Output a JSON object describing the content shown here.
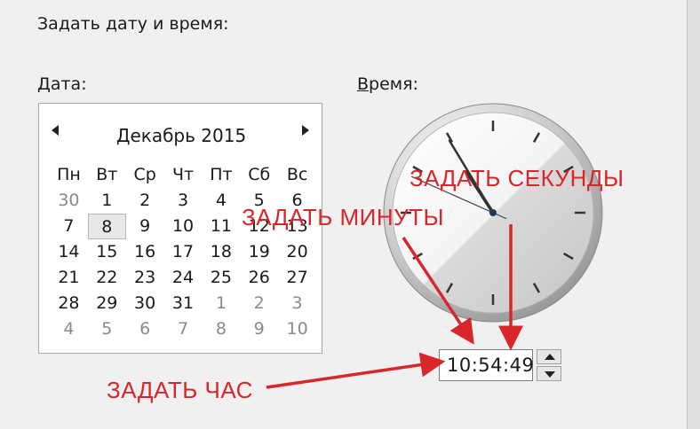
{
  "dialog": {
    "title": "Задать дату и время:",
    "date_label_accel": "Д",
    "date_label_rest": "ата:",
    "time_label_accel": "В",
    "time_label_rest": "ремя:"
  },
  "calendar": {
    "month_year": "Декабрь 2015",
    "weekdays": [
      "Пн",
      "Вт",
      "Ср",
      "Чт",
      "Пт",
      "Сб",
      "Вс"
    ],
    "weeks": [
      [
        {
          "d": "30",
          "o": true
        },
        {
          "d": "1"
        },
        {
          "d": "2"
        },
        {
          "d": "3"
        },
        {
          "d": "4"
        },
        {
          "d": "5"
        },
        {
          "d": "6"
        }
      ],
      [
        {
          "d": "7"
        },
        {
          "d": "8",
          "sel": true
        },
        {
          "d": "9"
        },
        {
          "d": "10"
        },
        {
          "d": "11"
        },
        {
          "d": "12"
        },
        {
          "d": "13"
        }
      ],
      [
        {
          "d": "14"
        },
        {
          "d": "15"
        },
        {
          "d": "16"
        },
        {
          "d": "17"
        },
        {
          "d": "18"
        },
        {
          "d": "19"
        },
        {
          "d": "20"
        }
      ],
      [
        {
          "d": "21"
        },
        {
          "d": "22"
        },
        {
          "d": "23"
        },
        {
          "d": "24"
        },
        {
          "d": "25"
        },
        {
          "d": "26"
        },
        {
          "d": "27"
        }
      ],
      [
        {
          "d": "28"
        },
        {
          "d": "29"
        },
        {
          "d": "30"
        },
        {
          "d": "31"
        },
        {
          "d": "1",
          "o": true
        },
        {
          "d": "2",
          "o": true
        },
        {
          "d": "3",
          "o": true
        }
      ],
      [
        {
          "d": "4",
          "o": true
        },
        {
          "d": "5",
          "o": true
        },
        {
          "d": "6",
          "o": true
        },
        {
          "d": "7",
          "o": true
        },
        {
          "d": "8",
          "o": true
        },
        {
          "d": "9",
          "o": true
        },
        {
          "d": "10",
          "o": true
        }
      ]
    ],
    "prev_icon": "triangle-left-icon",
    "next_icon": "triangle-right-icon"
  },
  "time": {
    "hour": 10,
    "minute": 54,
    "second": 49,
    "value": "10:54:49",
    "spin_up_icon": "triangle-up-icon",
    "spin_down_icon": "triangle-down-icon"
  },
  "annotations": {
    "seconds": "ЗАДАТЬ СЕКУНДЫ",
    "minutes": "ЗАДАТЬ МИНУТЫ",
    "hour": "ЗАДАТЬ ЧАС",
    "color": "#d9262a"
  }
}
